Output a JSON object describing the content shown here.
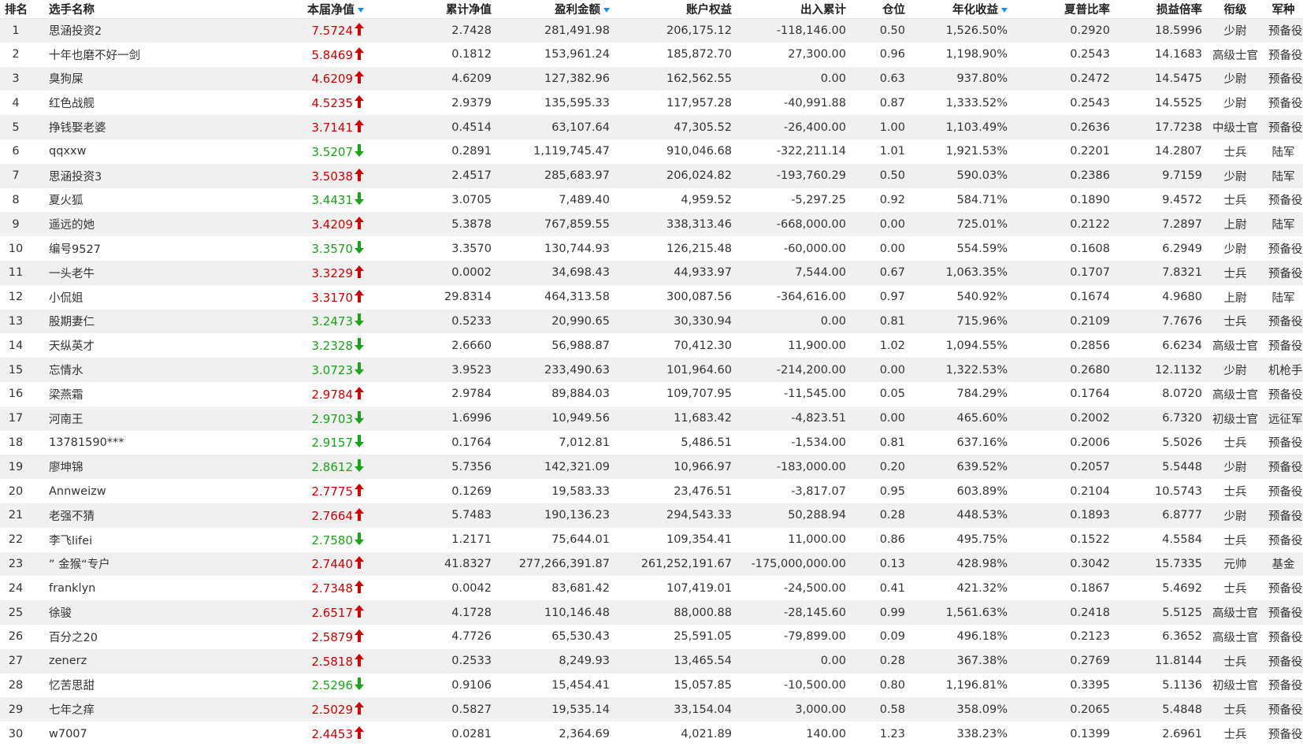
{
  "colors": {
    "up": "#cc0000",
    "down": "#1aa31a",
    "sort_indicator": "#1e8fe0",
    "row_alt": "#f0f0f0"
  },
  "header": {
    "rank": "排名",
    "name": "选手名称",
    "net": "本届净值",
    "cum_net": "累计净值",
    "profit": "盈利金额",
    "equity": "账户权益",
    "flow": "出入累计",
    "position": "仓位",
    "annual": "年化收益",
    "sharpe": "夏普比率",
    "pl_ratio": "损益倍率",
    "title_rank": "衔级",
    "army": "军种"
  },
  "rows": [
    {
      "rank": "1",
      "name": "思涵投资2",
      "net": "7.5724",
      "dir": "up",
      "cum_net": "2.7428",
      "profit": "281,491.98",
      "equity": "206,175.12",
      "flow": "-118,146.00",
      "position": "0.50",
      "annual": "1,526.50%",
      "sharpe": "0.2920",
      "pl_ratio": "18.5996",
      "title_rank": "少尉",
      "army": "预备役"
    },
    {
      "rank": "2",
      "name": "十年也磨不好一剑",
      "net": "5.8469",
      "dir": "up",
      "cum_net": "0.1812",
      "profit": "153,961.24",
      "equity": "185,872.70",
      "flow": "27,300.00",
      "position": "0.96",
      "annual": "1,198.90%",
      "sharpe": "0.2543",
      "pl_ratio": "14.1683",
      "title_rank": "高级士官",
      "army": "预备役"
    },
    {
      "rank": "3",
      "name": "臭狗屎",
      "net": "4.6209",
      "dir": "up",
      "cum_net": "4.6209",
      "profit": "127,382.96",
      "equity": "162,562.55",
      "flow": "0.00",
      "position": "0.63",
      "annual": "937.80%",
      "sharpe": "0.2472",
      "pl_ratio": "14.5475",
      "title_rank": "少尉",
      "army": "预备役"
    },
    {
      "rank": "4",
      "name": "红色战舰",
      "net": "4.5235",
      "dir": "up",
      "cum_net": "2.9379",
      "profit": "135,595.33",
      "equity": "117,957.28",
      "flow": "-40,991.88",
      "position": "0.87",
      "annual": "1,333.52%",
      "sharpe": "0.2543",
      "pl_ratio": "14.5525",
      "title_rank": "少尉",
      "army": "预备役"
    },
    {
      "rank": "5",
      "name": "挣钱娶老婆",
      "net": "3.7141",
      "dir": "up",
      "cum_net": "0.4514",
      "profit": "63,107.64",
      "equity": "47,305.52",
      "flow": "-26,400.00",
      "position": "1.00",
      "annual": "1,103.49%",
      "sharpe": "0.2636",
      "pl_ratio": "17.7238",
      "title_rank": "中级士官",
      "army": "预备役"
    },
    {
      "rank": "6",
      "name": "qqxxw",
      "net": "3.5207",
      "dir": "down",
      "cum_net": "0.2891",
      "profit": "1,119,745.47",
      "equity": "910,046.68",
      "flow": "-322,211.14",
      "position": "1.01",
      "annual": "1,921.53%",
      "sharpe": "0.2201",
      "pl_ratio": "14.2807",
      "title_rank": "士兵",
      "army": "陆军"
    },
    {
      "rank": "7",
      "name": "思涵投资3",
      "net": "3.5038",
      "dir": "up",
      "cum_net": "2.4517",
      "profit": "285,683.97",
      "equity": "206,024.82",
      "flow": "-193,760.29",
      "position": "0.50",
      "annual": "590.03%",
      "sharpe": "0.2386",
      "pl_ratio": "9.7159",
      "title_rank": "少尉",
      "army": "陆军"
    },
    {
      "rank": "8",
      "name": "夏火狐",
      "net": "3.4431",
      "dir": "down",
      "cum_net": "3.0705",
      "profit": "7,489.40",
      "equity": "4,959.52",
      "flow": "-5,297.25",
      "position": "0.92",
      "annual": "584.71%",
      "sharpe": "0.1890",
      "pl_ratio": "9.4572",
      "title_rank": "士兵",
      "army": "预备役"
    },
    {
      "rank": "9",
      "name": "遥远的她",
      "net": "3.4209",
      "dir": "up",
      "cum_net": "5.3878",
      "profit": "767,859.55",
      "equity": "338,313.46",
      "flow": "-668,000.00",
      "position": "0.00",
      "annual": "725.01%",
      "sharpe": "0.2122",
      "pl_ratio": "7.2897",
      "title_rank": "上尉",
      "army": "陆军"
    },
    {
      "rank": "10",
      "name": "编号9527",
      "net": "3.3570",
      "dir": "down",
      "cum_net": "3.3570",
      "profit": "130,744.93",
      "equity": "126,215.48",
      "flow": "-60,000.00",
      "position": "0.00",
      "annual": "554.59%",
      "sharpe": "0.1608",
      "pl_ratio": "6.2949",
      "title_rank": "少尉",
      "army": "预备役"
    },
    {
      "rank": "11",
      "name": "一头老牛",
      "net": "3.3229",
      "dir": "up",
      "cum_net": "0.0002",
      "profit": "34,698.43",
      "equity": "44,933.97",
      "flow": "7,544.00",
      "position": "0.67",
      "annual": "1,063.35%",
      "sharpe": "0.1707",
      "pl_ratio": "7.8321",
      "title_rank": "士兵",
      "army": "预备役"
    },
    {
      "rank": "12",
      "name": "小侃姐",
      "net": "3.3170",
      "dir": "up",
      "cum_net": "29.8314",
      "profit": "464,313.58",
      "equity": "300,087.56",
      "flow": "-364,616.00",
      "position": "0.97",
      "annual": "540.92%",
      "sharpe": "0.1674",
      "pl_ratio": "4.9680",
      "title_rank": "上尉",
      "army": "陆军"
    },
    {
      "rank": "13",
      "name": "股期妻仁",
      "net": "3.2473",
      "dir": "down",
      "cum_net": "0.5233",
      "profit": "20,990.65",
      "equity": "30,330.94",
      "flow": "0.00",
      "position": "0.81",
      "annual": "715.96%",
      "sharpe": "0.2109",
      "pl_ratio": "7.7676",
      "title_rank": "士兵",
      "army": "预备役"
    },
    {
      "rank": "14",
      "name": "天纵英才",
      "net": "3.2328",
      "dir": "down",
      "cum_net": "2.6660",
      "profit": "56,988.87",
      "equity": "70,412.30",
      "flow": "11,900.00",
      "position": "1.02",
      "annual": "1,094.55%",
      "sharpe": "0.2856",
      "pl_ratio": "6.6234",
      "title_rank": "高级士官",
      "army": "预备役"
    },
    {
      "rank": "15",
      "name": "忘情水",
      "net": "3.0723",
      "dir": "down",
      "cum_net": "3.9523",
      "profit": "233,490.63",
      "equity": "101,964.60",
      "flow": "-214,200.00",
      "position": "0.00",
      "annual": "1,322.53%",
      "sharpe": "0.2680",
      "pl_ratio": "12.1132",
      "title_rank": "少尉",
      "army": "机枪手特战营"
    },
    {
      "rank": "16",
      "name": "梁燕霜",
      "net": "2.9784",
      "dir": "up",
      "cum_net": "2.9784",
      "profit": "89,884.03",
      "equity": "109,707.95",
      "flow": "-11,545.00",
      "position": "0.05",
      "annual": "784.29%",
      "sharpe": "0.1764",
      "pl_ratio": "8.0720",
      "title_rank": "高级士官",
      "army": "预备役"
    },
    {
      "rank": "17",
      "name": "河南王",
      "net": "2.9703",
      "dir": "down",
      "cum_net": "1.6996",
      "profit": "10,949.56",
      "equity": "11,683.42",
      "flow": "-4,823.51",
      "position": "0.00",
      "annual": "465.60%",
      "sharpe": "0.2002",
      "pl_ratio": "6.7320",
      "title_rank": "初级士官",
      "army": "远征军"
    },
    {
      "rank": "18",
      "name": "13781590***",
      "net": "2.9157",
      "dir": "down",
      "cum_net": "0.1764",
      "profit": "7,012.81",
      "equity": "5,486.51",
      "flow": "-1,534.00",
      "position": "0.81",
      "annual": "637.16%",
      "sharpe": "0.2006",
      "pl_ratio": "5.5026",
      "title_rank": "士兵",
      "army": "预备役"
    },
    {
      "rank": "19",
      "name": "廖坤锦",
      "net": "2.8612",
      "dir": "down",
      "cum_net": "5.7356",
      "profit": "142,321.09",
      "equity": "10,966.97",
      "flow": "-183,000.00",
      "position": "0.20",
      "annual": "639.52%",
      "sharpe": "0.2057",
      "pl_ratio": "5.5448",
      "title_rank": "少尉",
      "army": "预备役"
    },
    {
      "rank": "20",
      "name": "Annweizw",
      "net": "2.7775",
      "dir": "up",
      "cum_net": "0.1269",
      "profit": "19,583.33",
      "equity": "23,476.51",
      "flow": "-3,817.07",
      "position": "0.95",
      "annual": "603.89%",
      "sharpe": "0.2104",
      "pl_ratio": "10.5743",
      "title_rank": "士兵",
      "army": "预备役"
    },
    {
      "rank": "21",
      "name": "老强不猜",
      "net": "2.7664",
      "dir": "up",
      "cum_net": "5.7483",
      "profit": "190,136.23",
      "equity": "294,543.33",
      "flow": "50,288.94",
      "position": "0.28",
      "annual": "448.53%",
      "sharpe": "0.1893",
      "pl_ratio": "6.8777",
      "title_rank": "少尉",
      "army": "预备役"
    },
    {
      "rank": "22",
      "name": "李飞lifei",
      "net": "2.7580",
      "dir": "down",
      "cum_net": "1.2171",
      "profit": "75,644.01",
      "equity": "109,354.41",
      "flow": "11,000.00",
      "position": "0.86",
      "annual": "495.75%",
      "sharpe": "0.1522",
      "pl_ratio": "4.5584",
      "title_rank": "士兵",
      "army": "预备役"
    },
    {
      "rank": "23",
      "name": "” 金猴“专户",
      "net": "2.7440",
      "dir": "up",
      "cum_net": "41.8327",
      "profit": "277,266,391.87",
      "equity": "261,252,191.67",
      "flow": "-175,000,000.00",
      "position": "0.13",
      "annual": "428.98%",
      "sharpe": "0.3042",
      "pl_ratio": "15.7335",
      "title_rank": "元帅",
      "army": "基金"
    },
    {
      "rank": "24",
      "name": "franklyn",
      "net": "2.7348",
      "dir": "up",
      "cum_net": "0.0042",
      "profit": "83,681.42",
      "equity": "107,419.01",
      "flow": "-24,500.00",
      "position": "0.41",
      "annual": "421.32%",
      "sharpe": "0.1867",
      "pl_ratio": "5.4692",
      "title_rank": "士兵",
      "army": "预备役"
    },
    {
      "rank": "25",
      "name": "徐骏",
      "net": "2.6517",
      "dir": "up",
      "cum_net": "4.1728",
      "profit": "110,146.48",
      "equity": "88,000.88",
      "flow": "-28,145.60",
      "position": "0.99",
      "annual": "1,561.63%",
      "sharpe": "0.2418",
      "pl_ratio": "5.5125",
      "title_rank": "高级士官",
      "army": "预备役"
    },
    {
      "rank": "26",
      "name": "百分之20",
      "net": "2.5879",
      "dir": "up",
      "cum_net": "4.7726",
      "profit": "65,530.43",
      "equity": "25,591.05",
      "flow": "-79,899.00",
      "position": "0.09",
      "annual": "496.18%",
      "sharpe": "0.2123",
      "pl_ratio": "6.3652",
      "title_rank": "高级士官",
      "army": "预备役"
    },
    {
      "rank": "27",
      "name": "zenerz",
      "net": "2.5818",
      "dir": "up",
      "cum_net": "0.2533",
      "profit": "8,249.93",
      "equity": "13,465.54",
      "flow": "0.00",
      "position": "0.28",
      "annual": "367.38%",
      "sharpe": "0.2769",
      "pl_ratio": "11.8144",
      "title_rank": "士兵",
      "army": "预备役"
    },
    {
      "rank": "28",
      "name": "忆苦思甜",
      "net": "2.5296",
      "dir": "down",
      "cum_net": "0.9106",
      "profit": "15,454.41",
      "equity": "15,057.85",
      "flow": "-10,500.00",
      "position": "0.80",
      "annual": "1,196.81%",
      "sharpe": "0.3395",
      "pl_ratio": "5.1136",
      "title_rank": "初级士官",
      "army": "预备役"
    },
    {
      "rank": "29",
      "name": "七年之痒",
      "net": "2.5029",
      "dir": "up",
      "cum_net": "0.5827",
      "profit": "19,535.14",
      "equity": "33,154.04",
      "flow": "3,000.00",
      "position": "0.58",
      "annual": "358.09%",
      "sharpe": "0.2065",
      "pl_ratio": "5.4848",
      "title_rank": "士兵",
      "army": "预备役"
    },
    {
      "rank": "30",
      "name": "w7007",
      "net": "2.4453",
      "dir": "up",
      "cum_net": "0.0281",
      "profit": "2,364.69",
      "equity": "4,021.89",
      "flow": "140.00",
      "position": "1.23",
      "annual": "338.23%",
      "sharpe": "0.1399",
      "pl_ratio": "2.6961",
      "title_rank": "士兵",
      "army": "预备役"
    }
  ]
}
